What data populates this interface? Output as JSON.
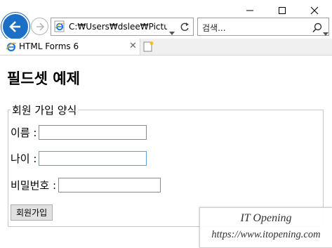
{
  "window": {
    "minimize_glyph": "—",
    "maximize_glyph": "☐",
    "close_glyph": "✕"
  },
  "toolbar": {
    "address_value": "C:₩Users₩dslee₩Pictures₩",
    "search_placeholder": "검색..."
  },
  "tab": {
    "title": "HTML Forms 6",
    "close_glyph": "✕"
  },
  "page": {
    "heading": "필드셋 예제",
    "legend": "회원 가입 양식",
    "fields": [
      {
        "label": "이름 :",
        "value": ""
      },
      {
        "label": "나이 :",
        "value": ""
      },
      {
        "label": "비밀번호 :",
        "value": ""
      }
    ],
    "submit_label": "회원가입"
  },
  "watermark": {
    "brand": "IT Opening",
    "url": "https://www.itopening.com"
  },
  "colors": {
    "back_button": "#1c6fc6",
    "focus_border": "#5aa2d8"
  }
}
